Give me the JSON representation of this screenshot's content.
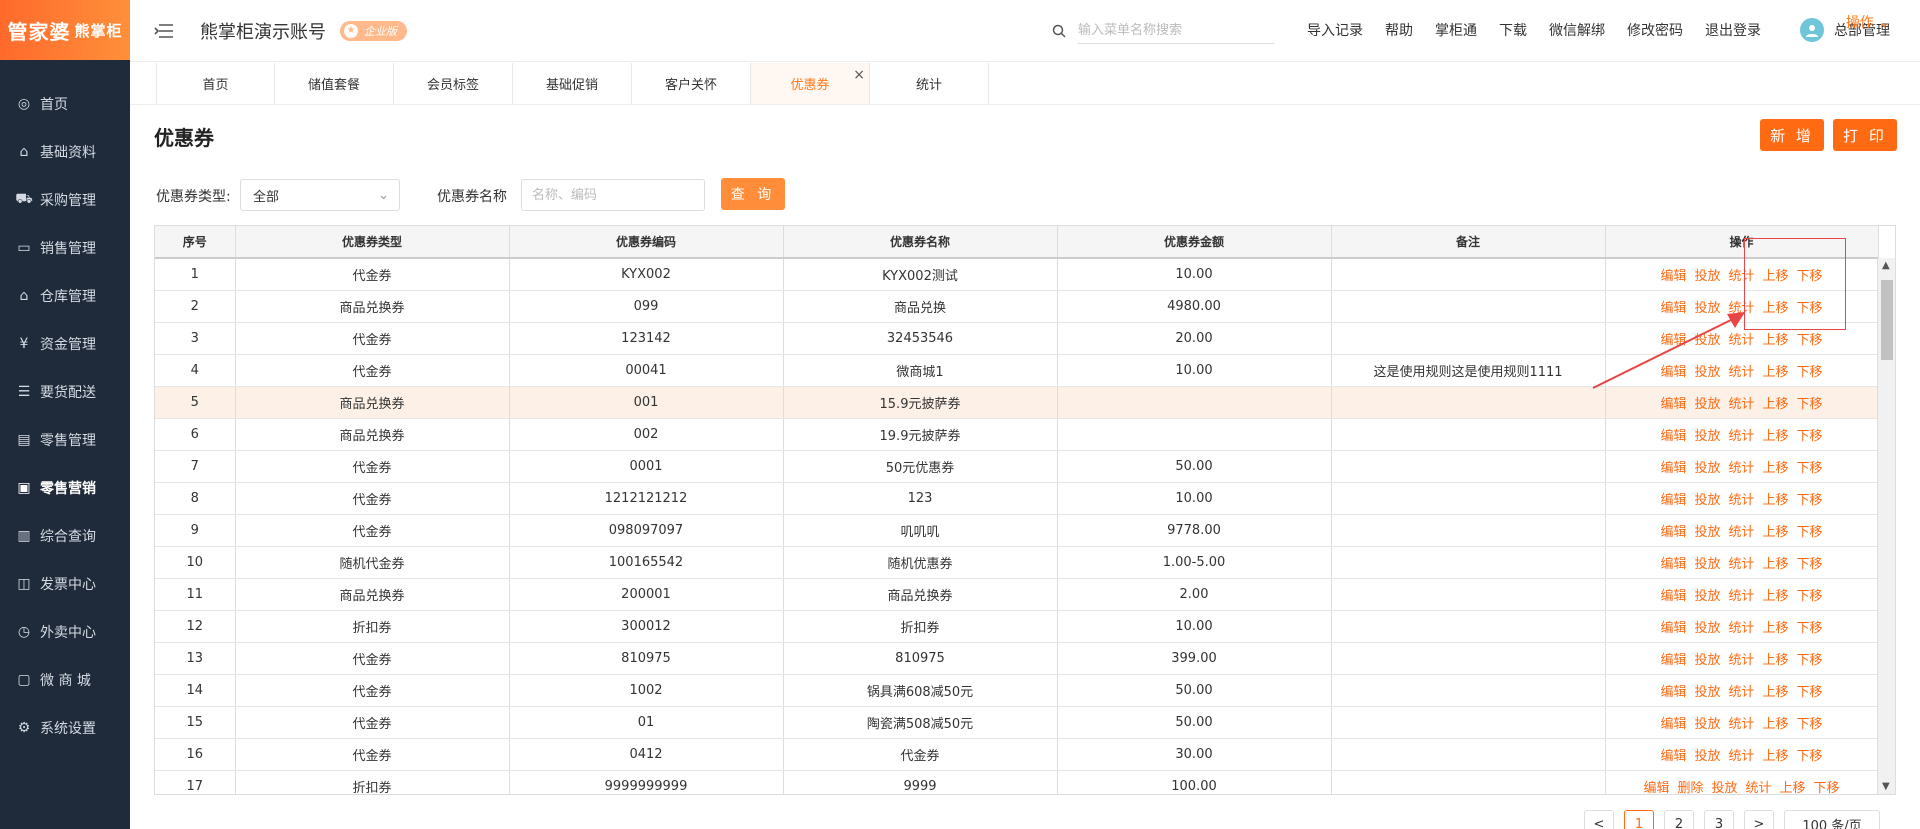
{
  "brand": {
    "logo_main": "管家婆",
    "logo_sub": "熊掌柜"
  },
  "sidebar": {
    "items": [
      {
        "label": "首页",
        "icon": "globe-icon"
      },
      {
        "label": "基础资料",
        "icon": "home-icon"
      },
      {
        "label": "采购管理",
        "icon": "cart-icon"
      },
      {
        "label": "销售管理",
        "icon": "monitor-icon"
      },
      {
        "label": "仓库管理",
        "icon": "warehouse-icon"
      },
      {
        "label": "资金管理",
        "icon": "money-icon"
      },
      {
        "label": "要货配送",
        "icon": "list-icon"
      },
      {
        "label": "零售管理",
        "icon": "chart-icon"
      },
      {
        "label": "零售营销",
        "icon": "gift-icon"
      },
      {
        "label": "综合查询",
        "icon": "bar-chart-icon"
      },
      {
        "label": "发票中心",
        "icon": "line-chart-icon"
      },
      {
        "label": "外卖中心",
        "icon": "delivery-icon"
      },
      {
        "label": "微 商 城",
        "icon": "shop-icon"
      },
      {
        "label": "系统设置",
        "icon": "gear-icon"
      }
    ]
  },
  "header": {
    "account": "熊掌柜演示账号",
    "badge": "企业版",
    "search_placeholder": "输入菜单名称搜索",
    "links": [
      "导入记录",
      "帮助",
      "掌柜通",
      "下载",
      "微信解绑",
      "修改密码",
      "退出登录"
    ],
    "user": "总部管理"
  },
  "tabs": [
    "首页",
    "储值套餐",
    "会员标签",
    "基础促销",
    "客户关怀",
    "优惠券",
    "统计"
  ],
  "operation_menu": "操作",
  "page": {
    "title": "优惠券",
    "add_label": "新 增",
    "print_label": "打 印"
  },
  "filter": {
    "type_label": "优惠券类型:",
    "type_value": "全部",
    "name_label": "优惠券名称",
    "name_placeholder": "名称、编码",
    "query_label": "查 询"
  },
  "table": {
    "columns": [
      "序号",
      "优惠券类型",
      "优惠券编码",
      "优惠券名称",
      "优惠券金额",
      "备注",
      "操作"
    ],
    "rows": [
      [
        "1",
        "代金券",
        "KYX002",
        "KYX002测试",
        "10.00",
        ""
      ],
      [
        "2",
        "商品兑换券",
        "099",
        "商品兑换",
        "4980.00",
        ""
      ],
      [
        "3",
        "代金券",
        "123142",
        "32453546",
        "20.00",
        ""
      ],
      [
        "4",
        "代金券",
        "00041",
        "微商城1",
        "10.00",
        "这是使用规则这是使用规则1111"
      ],
      [
        "5",
        "商品兑换券",
        "001",
        "15.9元披萨券",
        "",
        ""
      ],
      [
        "6",
        "商品兑换券",
        "002",
        "19.9元披萨券",
        "",
        ""
      ],
      [
        "7",
        "代金券",
        "0001",
        "50元优惠券",
        "50.00",
        ""
      ],
      [
        "8",
        "代金券",
        "1212121212",
        "123",
        "10.00",
        ""
      ],
      [
        "9",
        "代金券",
        "098097097",
        "叽叽叽",
        "9778.00",
        ""
      ],
      [
        "10",
        "随机代金券",
        "100165542",
        "随机优惠券",
        "1.00-5.00",
        ""
      ],
      [
        "11",
        "商品兑换券",
        "200001",
        "商品兑换券",
        "2.00",
        ""
      ],
      [
        "12",
        "折扣券",
        "300012",
        "折扣券",
        "10.00",
        ""
      ],
      [
        "13",
        "代金券",
        "810975",
        "810975",
        "399.00",
        ""
      ],
      [
        "14",
        "代金券",
        "1002",
        "锅具满608减50元",
        "50.00",
        ""
      ],
      [
        "15",
        "代金券",
        "01",
        "陶瓷满508减50元",
        "50.00",
        ""
      ],
      [
        "16",
        "代金券",
        "0412",
        "代金券",
        "30.00",
        ""
      ],
      [
        "17",
        "折扣券",
        "9999999999",
        "9999",
        "100.00",
        ""
      ]
    ],
    "ops": [
      "编辑",
      "投放",
      "统计",
      "上移",
      "下移"
    ],
    "ops_row17": [
      "编辑",
      "删除",
      "投放",
      "统计",
      "上移",
      "下移"
    ]
  },
  "pagination": {
    "prev": "<",
    "pages": [
      "1",
      "2",
      "3"
    ],
    "next": ">",
    "size": "100 条/页"
  },
  "colors": {
    "accent": "#ff6a13",
    "sidebar_bg": "#1f2a3a",
    "highlight_row": "#fdf1e7",
    "annotation": "#e84646"
  }
}
